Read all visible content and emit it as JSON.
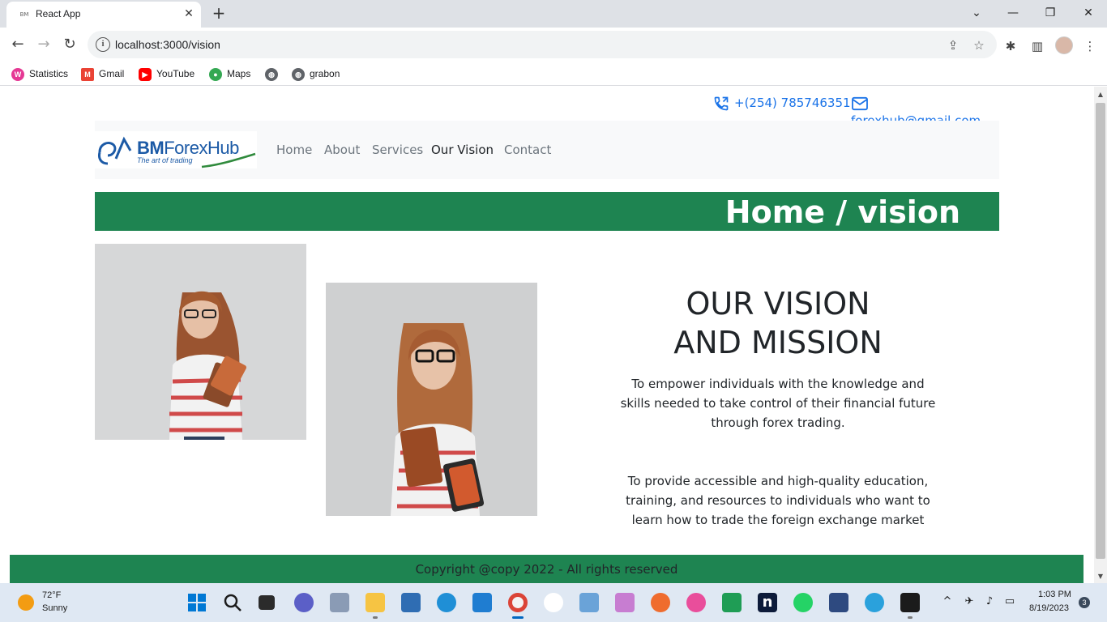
{
  "browser": {
    "tab_title": "React App",
    "tab_favicon_text": "BM",
    "url": "localhost:3000/vision",
    "bookmarks": [
      {
        "label": "Statistics",
        "icon": "statistics-icon",
        "color": "#e53994"
      },
      {
        "label": "Gmail",
        "icon": "gmail-icon",
        "color": "#ea4335"
      },
      {
        "label": "YouTube",
        "icon": "youtube-icon",
        "color": "#ff0000"
      },
      {
        "label": "Maps",
        "icon": "maps-icon",
        "color": "#34a853"
      },
      {
        "label": "",
        "icon": "globe-icon",
        "color": "#5f6368"
      },
      {
        "label": "grabon",
        "icon": "globe-icon",
        "color": "#5f6368"
      }
    ]
  },
  "site": {
    "phone": "+(254) 785746351",
    "email": "forexhub@gmail.com",
    "logo": {
      "bm": "BM",
      "name": "ForexHub",
      "tagline": "The art of trading"
    },
    "nav": [
      {
        "label": "Home",
        "active": false
      },
      {
        "label": "About",
        "active": false
      },
      {
        "label": "Services",
        "active": false
      },
      {
        "label": "Our Vision",
        "active": true
      },
      {
        "label": "Contact",
        "active": false
      }
    ],
    "banner": "Home / vision",
    "vision": {
      "title_line1": "OUR VISION",
      "title_line2": "AND MISSION",
      "para1": "To empower individuals with the knowledge and skills needed to take control of their financial future through forex trading.",
      "para2": "To provide accessible and high-quality education, training, and resources to individuals who want to learn how to trade the foreign exchange market"
    },
    "footer": "Copyright @copy 2022 - All rights reserved",
    "accent_color": "#1e8451",
    "link_color": "#1a73e8"
  },
  "taskbar": {
    "temperature": "72°F",
    "condition": "Sunny",
    "time": "1:03 PM",
    "date": "8/19/2023",
    "notification_count": "3"
  }
}
